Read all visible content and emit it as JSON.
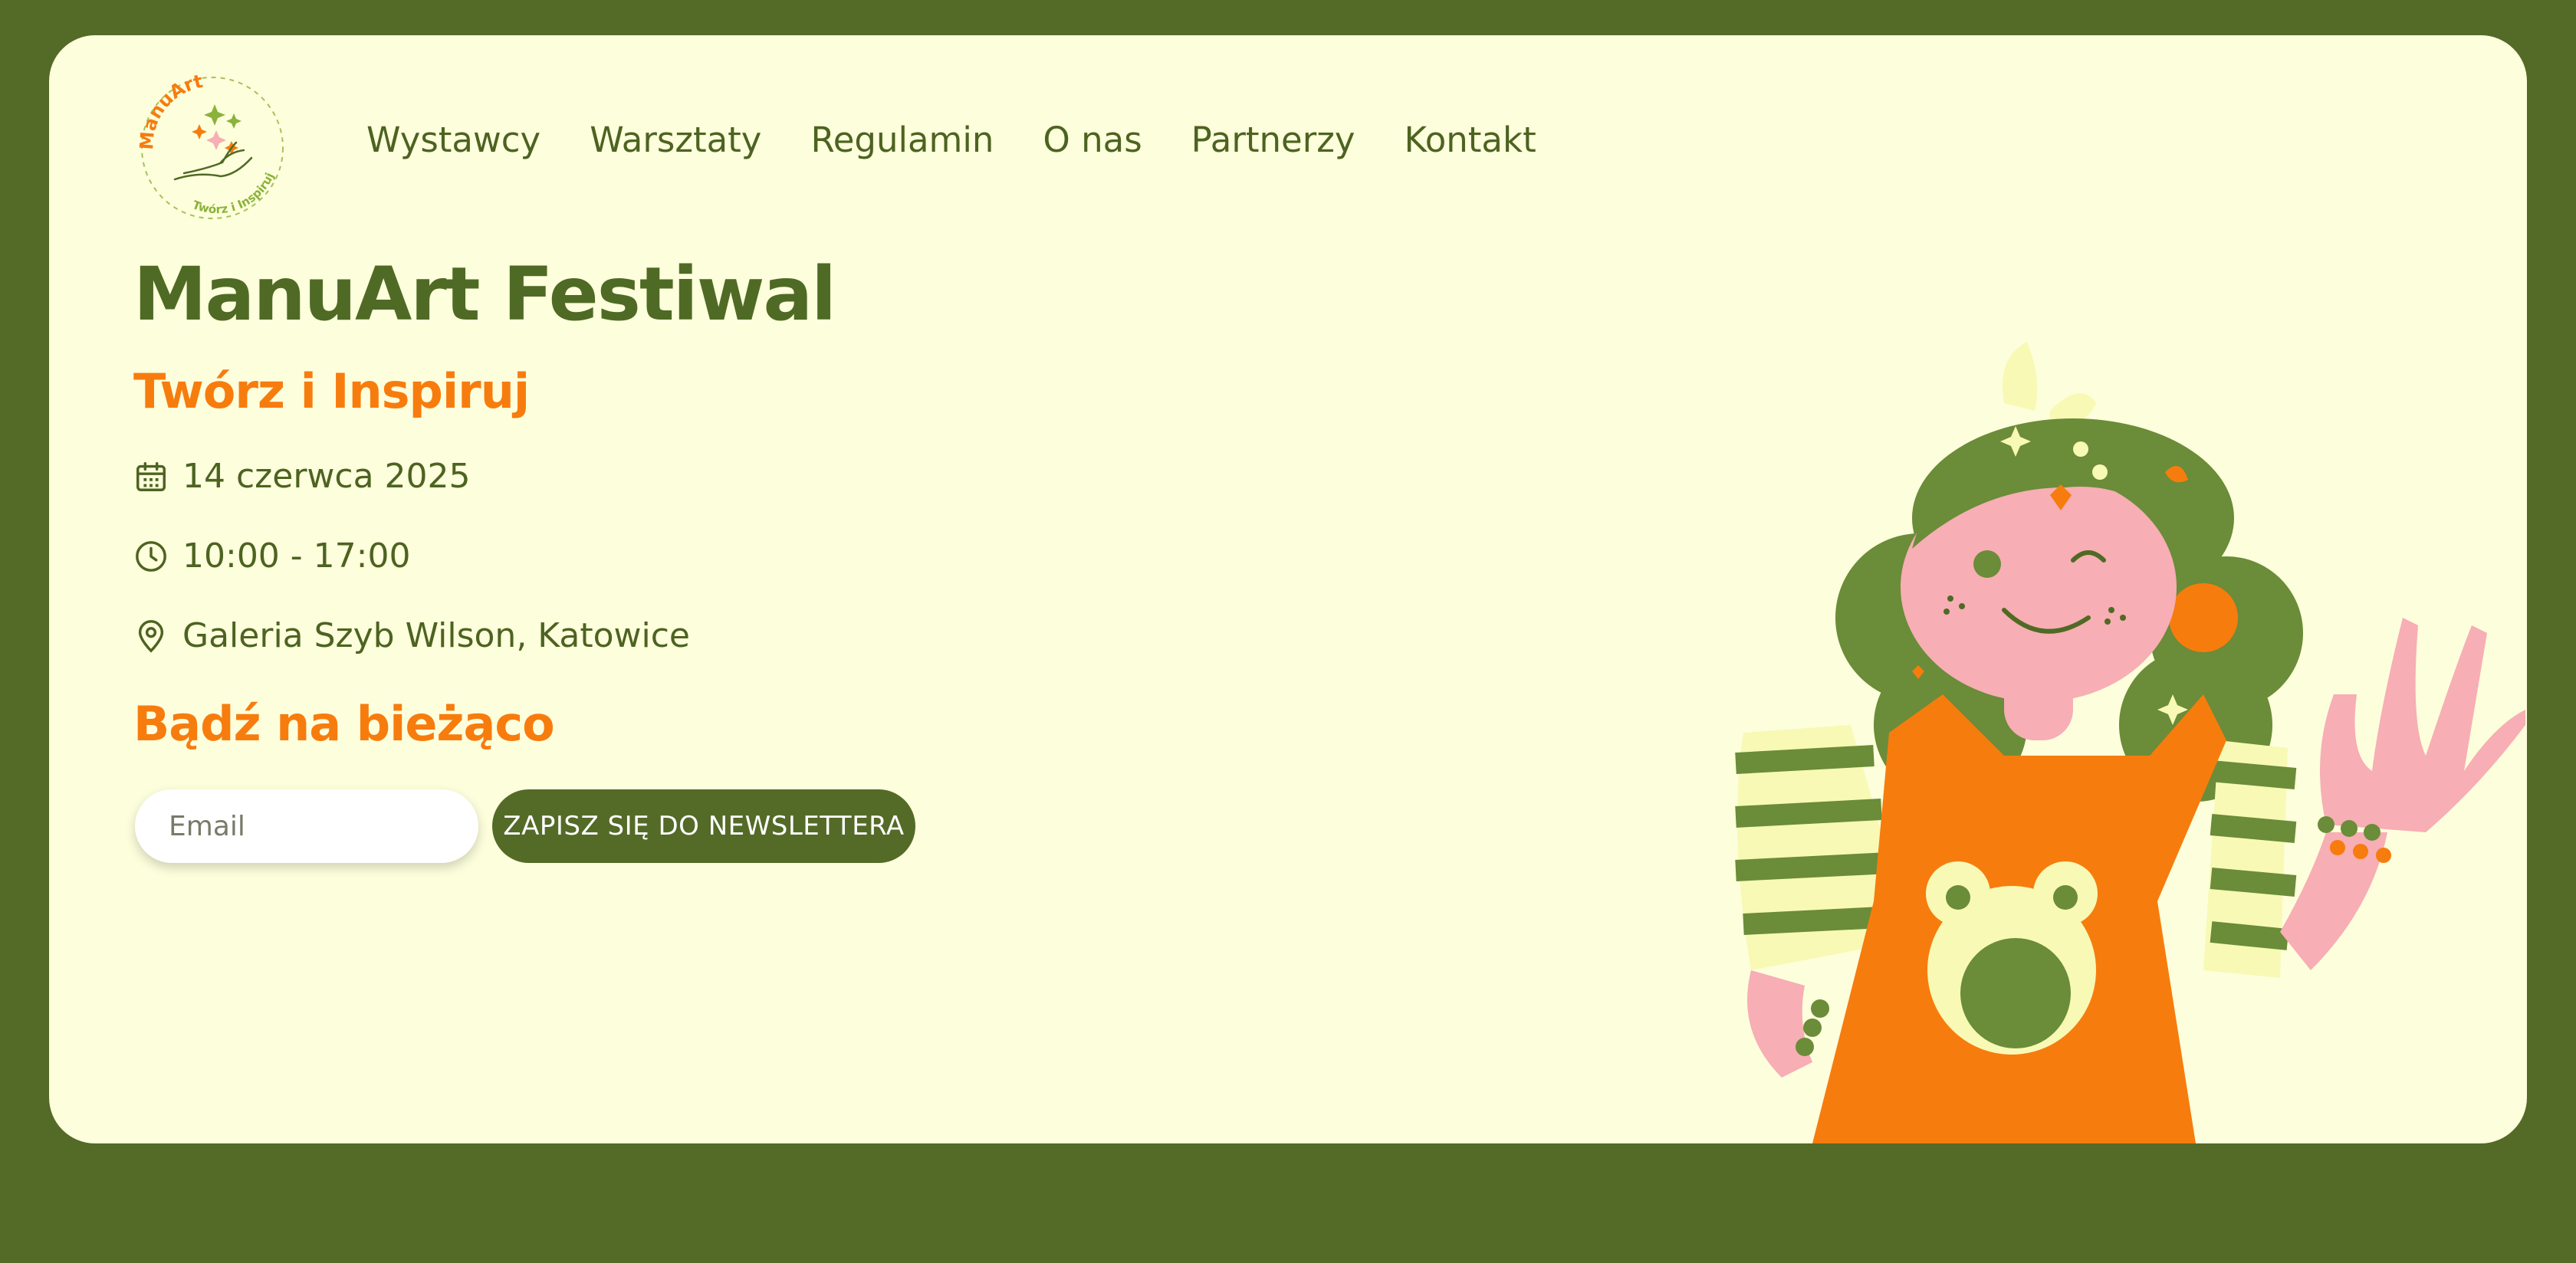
{
  "logo": {
    "brand": "ManuArt",
    "tagline": "Twórz i Inspiruj"
  },
  "nav": {
    "items": [
      {
        "label": "Wystawcy"
      },
      {
        "label": "Warsztaty"
      },
      {
        "label": "Regulamin"
      },
      {
        "label": "O nas"
      },
      {
        "label": "Partnerzy"
      },
      {
        "label": "Kontakt"
      }
    ]
  },
  "hero": {
    "title": "ManuArt Festiwal",
    "subtitle": "Twórz i Inspiruj",
    "date": "14 czerwca 2025",
    "time": "10:00 - 17:00",
    "location": "Galeria Szyb Wilson, Katowice"
  },
  "newsletter": {
    "title": "Bądź na bieżąco",
    "email_placeholder": "Email",
    "email_value": "",
    "button_label": "ZAPISZ SIĘ DO NEWSLETTERA"
  },
  "icons": {
    "date": "calendar-icon",
    "time": "clock-icon",
    "location": "map-pin-icon"
  },
  "colors": {
    "background": "#546a27",
    "card": "#fdfedc",
    "primary_green": "#4f6a24",
    "accent_orange": "#f77c0e",
    "skin_pink": "#f7aeb4",
    "leaf_green": "#6b8c38"
  }
}
